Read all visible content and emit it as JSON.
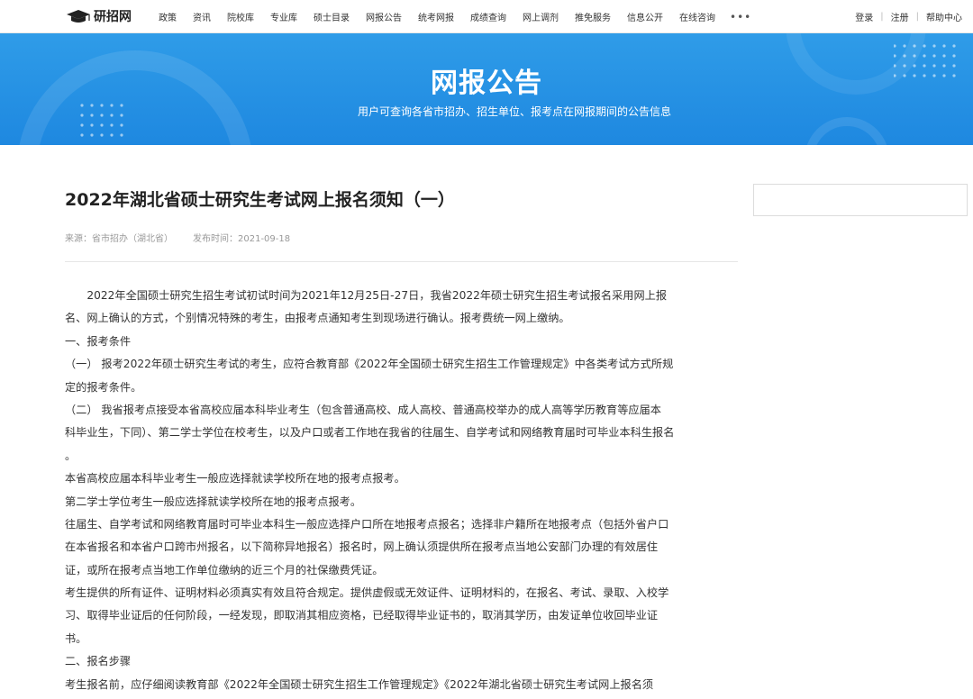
{
  "logo": {
    "text": "研招网"
  },
  "nav": {
    "items": [
      "政策",
      "资讯",
      "院校库",
      "专业库",
      "硕士目录",
      "网报公告",
      "统考网报",
      "成绩查询",
      "网上调剂",
      "推免服务",
      "信息公开",
      "在线咨询"
    ],
    "more": "•••",
    "login": "登录",
    "register": "注册",
    "help": "帮助中心",
    "separator": "|"
  },
  "banner": {
    "title": "网报公告",
    "subtitle": "用户可查询各省市招办、招生单位、报考点在网报期间的公告信息"
  },
  "article": {
    "title": "2022年湖北省硕士研究生考试网上报名须知（一）",
    "source": "来源：省市招办（湖北省）",
    "date": "发布时间：2021-09-18",
    "lines": [
      "　　2022年全国硕士研究生招生考试初试时间为2021年12月25日-27日，我省2022年硕士研究生招生考试报名采用网上报",
      "名、网上确认的方式，个别情况特殊的考生，由报考点通知考生到现场进行确认。报考费统一网上缴纳。",
      "一、报考条件",
      "（一） 报考2022年硕士研究生考试的考生，应符合教育部《2022年全国硕士研究生招生工作管理规定》中各类考试方式所规",
      "定的报考条件。",
      "（二） 我省报考点接受本省高校应届本科毕业考生（包含普通高校、成人高校、普通高校举办的成人高等学历教育等应届本",
      "科毕业生，下同）、第二学士学位在校考生，以及户口或者工作地在我省的往届生、自学考试和网络教育届时可毕业本科生报名",
      "。",
      "本省高校应届本科毕业考生一般应选择就读学校所在地的报考点报考。",
      "第二学士学位考生一般应选择就读学校所在地的报考点报考。",
      "往届生、自学考试和网络教育届时可毕业本科生一般应选择户口所在地报考点报名；选择非户籍所在地报考点（包括外省户口",
      "在本省报名和本省户口跨市州报名，以下简称异地报名）报名时，网上确认须提供所在报考点当地公安部门办理的有效居住",
      "证，或所在报考点当地工作单位缴纳的近三个月的社保缴费凭证。",
      "考生提供的所有证件、证明材料必须真实有效且符合规定。提供虚假或无效证件、证明材料的，在报名、考试、录取、入校学",
      "习、取得毕业证后的任何阶段，一经发现，即取消其相应资格，已经取得毕业证书的，取消其学历，由发证单位收回毕业证",
      "书。",
      "二、报名步骤",
      "考生报名前，应仔细阅读教育部《2022年全国硕士研究生招生工作管理规定》《2022年湖北省硕士研究生考试网上报名须"
    ]
  }
}
